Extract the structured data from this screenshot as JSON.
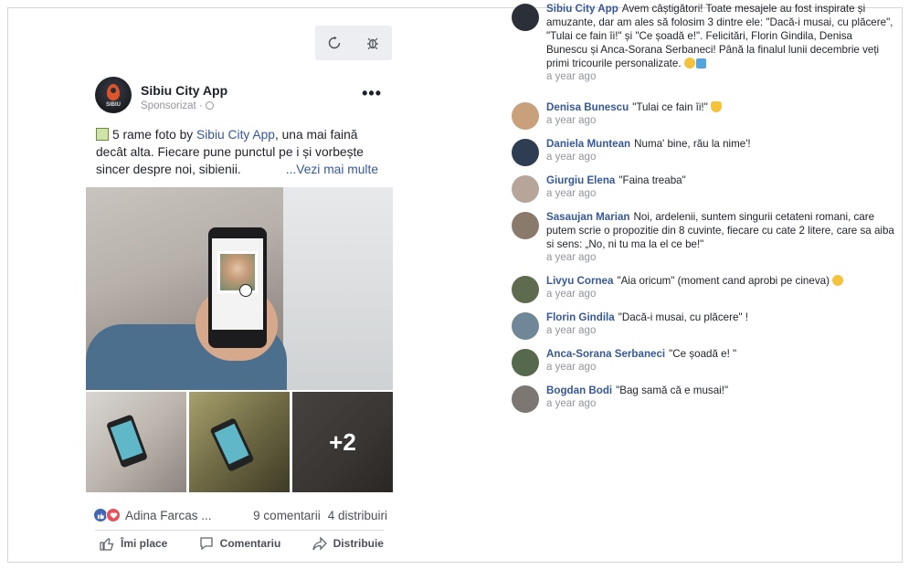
{
  "toolbar": {
    "refresh_icon": "refresh-icon",
    "bug_icon": "bug-icon"
  },
  "post": {
    "page_name": "Sibiu City App",
    "avatar_text": "SIBIU",
    "sponsored": "Sponsorizat · ",
    "text_part1": "5 rame foto by ",
    "text_link": "Sibiu City App",
    "text_part2": ", una mai faină decât alta. Fiecare pune punctul pe i și vorbește sincer despre noi, sibienii.",
    "see_more": "...Vezi mai multe",
    "extra_photos": "+2",
    "reactions_names": "Adina Farcas ...",
    "comments_count": "9 comentarii",
    "shares_count": "4 distribuiri",
    "actions": {
      "like": "Îmi place",
      "comment": "Comentariu",
      "share": "Distribuie"
    }
  },
  "comments": [
    {
      "name": "Sibiu City App",
      "text": "Avem câștigători! Toate mesajele au fost inspirate și amuzante, dar am ales să folosim 3 dintre ele: \"Dacă-i musai, cu plăcere\", \"Tulai ce fain îi!\" și \"Ce șoadă e!\". Felicitări, Florin Gindila, Denisa Bunescu și Anca-Sorana Serbaneci! Până la finalul lunii decembrie veți primi tricourile personalizate.",
      "time": "a year ago",
      "avatar_color": "#2b2f38"
    },
    {
      "name": "Denisa Bunescu",
      "text": "\"Tulai ce fain îi!\"",
      "time": "a year ago",
      "avatar_color": "#c9a07c"
    },
    {
      "name": "Daniela Muntean",
      "text": "Numa' bine, rău la nime'!",
      "time": "a year ago",
      "avatar_color": "#2f3d52"
    },
    {
      "name": "Giurgiu Elena",
      "text": "\"Faina treaba\"",
      "time": "a year ago",
      "avatar_color": "#b8a59a"
    },
    {
      "name": "Sasaujan Marian",
      "text": "Noi, ardelenii, suntem singurii cetateni romani, care putem scrie o propozitie din 8 cuvinte, fiecare cu cate 2 litere, care sa aiba si sens: „No, ni tu ma la el ce be!\"",
      "time": "a year ago",
      "avatar_color": "#8a7a6c"
    },
    {
      "name": "Livyu Cornea",
      "text": "\"Aia oricum\" (moment cand aprobi pe cineva)",
      "time": "a year ago",
      "avatar_color": "#5e6b4e"
    },
    {
      "name": "Florin Gindila",
      "text": "\"Dacă-i musai, cu plăcere\" !",
      "time": "a year ago",
      "avatar_color": "#6f8796"
    },
    {
      "name": "Anca-Sorana Serbaneci",
      "text": "\"Ce șoadă e! \"",
      "time": "a year ago",
      "avatar_color": "#56694d"
    },
    {
      "name": "Bogdan Bodi",
      "text": "\"Bag samă că e musai!\"",
      "time": "a year ago",
      "avatar_color": "#7c7772"
    }
  ]
}
